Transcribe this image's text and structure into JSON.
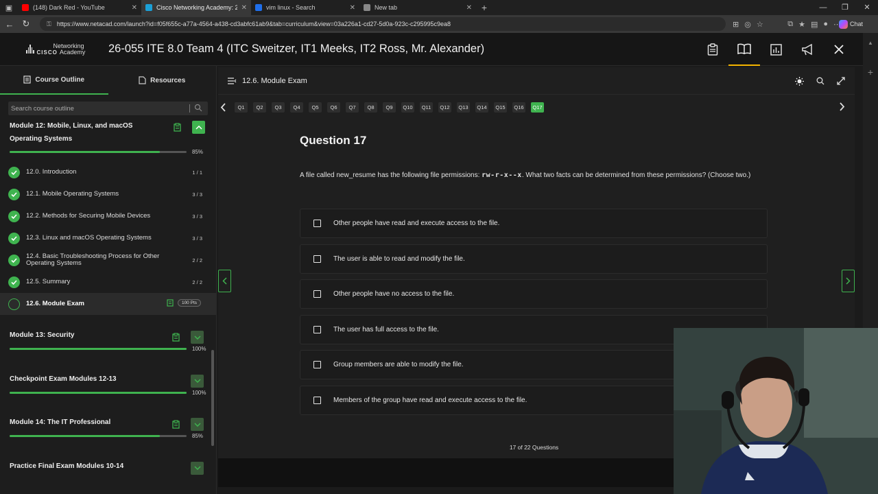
{
  "browser": {
    "tabs": [
      {
        "title": "(148) Dark Red - YouTube",
        "favicon_color": "#ff0000",
        "active": false
      },
      {
        "title": "Cisco Networking Academy: 26-0",
        "favicon_color": "#1ba0d7",
        "active": true
      },
      {
        "title": "vim linux - Search",
        "favicon_color": "#1f6feb",
        "active": false
      },
      {
        "title": "New tab",
        "favicon_color": "#888888",
        "active": false
      }
    ],
    "url": "https://www.netacad.com/launch?id=f05f655c-a77a-4564-a438-cd3abfc61ab9&tab=curriculum&view=03a226a1-cd27-5d0a-923c-c295995c9ea8",
    "chat_label": "Chat"
  },
  "app": {
    "logo_line1": "Networking",
    "logo_line2": "Academy",
    "logo_brand": "CISCO",
    "course_title": "26-055 ITE 8.0 Team 4 (ITC Sweitzer, IT1 Meeks, IT2 Ross, Mr. Alexander)"
  },
  "sidebar": {
    "tab_outline": "Course Outline",
    "tab_resources": "Resources",
    "search_placeholder": "Search course outline",
    "current_module": {
      "title": "Module 12: Mobile, Linux, and macOS Operating Systems",
      "progress_label": "85%",
      "progress_value": 0.85
    },
    "lessons": [
      {
        "title": "12.0. Introduction",
        "count": "1 / 1"
      },
      {
        "title": "12.1. Mobile Operating Systems",
        "count": "3 / 3"
      },
      {
        "title": "12.2. Methods for Securing Mobile Devices",
        "count": "3 / 3"
      },
      {
        "title": "12.3. Linux and macOS Operating Systems",
        "count": "3 / 3"
      },
      {
        "title": "12.4. Basic Troubleshooting Process for Other Operating Systems",
        "count": "2 / 2"
      },
      {
        "title": "12.5. Summary",
        "count": "2 / 2"
      }
    ],
    "active_lesson": {
      "title": "12.6. Module Exam",
      "badge": "100 Pts"
    },
    "modules": [
      {
        "title": "Module 13: Security",
        "progress_label": "100%",
        "progress_value": 1.0,
        "has_clip": true
      },
      {
        "title": "Checkpoint Exam Modules 12-13",
        "progress_label": "100%",
        "progress_value": 1.0,
        "has_clip": false
      },
      {
        "title": "Module 14: The IT Professional",
        "progress_label": "85%",
        "progress_value": 0.85,
        "has_clip": true
      },
      {
        "title": "Practice Final Exam Modules 10-14",
        "progress_label": "",
        "progress_value": 0,
        "has_clip": false
      }
    ]
  },
  "main": {
    "breadcrumb": "12.6. Module Exam",
    "questions": [
      "Q1",
      "Q2",
      "Q3",
      "Q4",
      "Q5",
      "Q6",
      "Q7",
      "Q8",
      "Q9",
      "Q10",
      "Q11",
      "Q12",
      "Q13",
      "Q14",
      "Q15",
      "Q16",
      "Q17"
    ],
    "current_question": "Q17",
    "question_title": "Question 17",
    "question_text_before": "A file called new_resume has the following file permissions: ",
    "question_permissions": "rw-r-x--x",
    "question_text_after": ". What two facts can be determined from these permissions? (Choose two.)",
    "options": [
      "Other people have read and execute access to the file.",
      "The user is able to read and modify the file.",
      "Other people have no access to the file.",
      "The user has full access to the file.",
      "Group members are able to modify the file.",
      "Members of the group have read and execute access to the file."
    ],
    "counter": "17 of 22 Questions"
  },
  "colors": {
    "accent_green": "#3fb34f",
    "header_active": "#f4b400",
    "background": "#1b1b1b"
  }
}
